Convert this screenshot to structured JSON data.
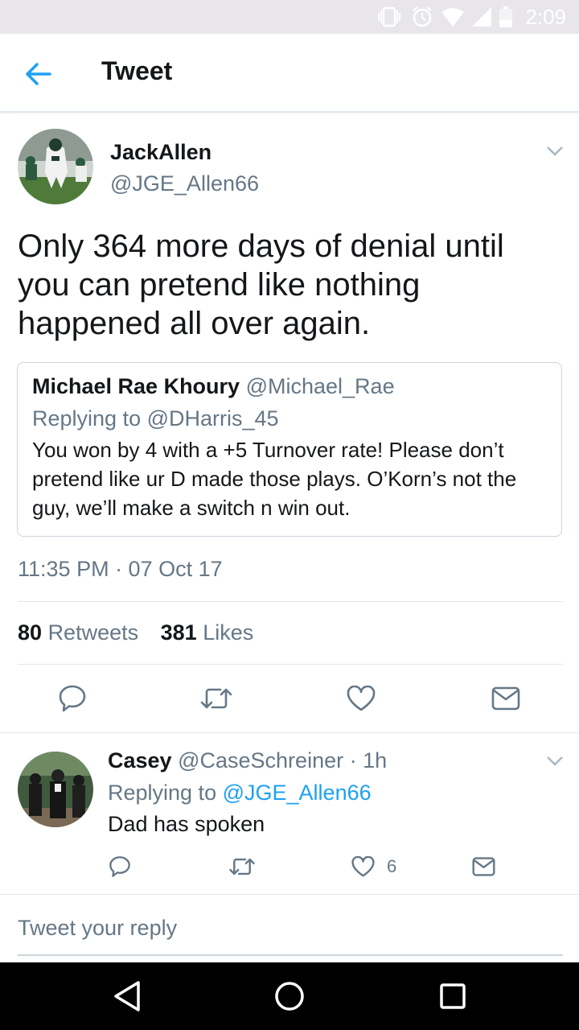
{
  "status_bar": {
    "time": "2:09"
  },
  "app_bar": {
    "title": "Tweet"
  },
  "tweet": {
    "name": "JackAllen",
    "handle": "@JGE_Allen66",
    "text": "Only 364 more days of denial until you can pretend like nothing happened all over again.",
    "quoted": {
      "name": "Michael Rae Khoury",
      "handle": "@Michael_Rae",
      "replying_to": "Replying to @DHarris_45",
      "text": "You won by 4 with a +5 Turnover rate! Please don’t pretend like ur D made those plays. O’Korn’s not the guy, we’ll make a switch n win out."
    },
    "timestamp": "11:35 PM · 07 Oct 17",
    "retweets_count": "80",
    "retweets_label": "Retweets",
    "likes_count": "381",
    "likes_label": "Likes"
  },
  "reply": {
    "name": "Casey",
    "handle": "@CaseSchreiner · 1h",
    "replying_prefix": "Replying to",
    "replying_handle": "@JGE_Allen66",
    "text": "Dad has spoken",
    "like_count": "6"
  },
  "composer": {
    "placeholder": "Tweet your reply"
  },
  "icons": {
    "back": "arrow-left-icon",
    "caret": "chevron-down-icon",
    "reply": "reply-icon",
    "retweet": "retweet-icon",
    "like": "heart-icon",
    "dm": "envelope-icon"
  },
  "colors": {
    "accent": "#1da1f2",
    "text": "#14171a",
    "secondary": "#657786",
    "border": "#e1e8ed"
  }
}
